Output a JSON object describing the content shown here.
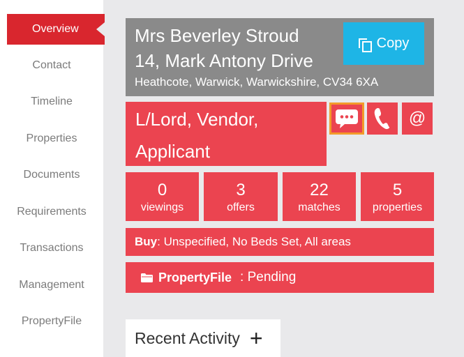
{
  "sidebar": {
    "items": [
      {
        "label": "Overview",
        "active": true
      },
      {
        "label": "Contact"
      },
      {
        "label": "Timeline"
      },
      {
        "label": "Properties"
      },
      {
        "label": "Documents"
      },
      {
        "label": "Requirements"
      },
      {
        "label": "Transactions"
      },
      {
        "label": "Management"
      },
      {
        "label": "PropertyFile"
      }
    ]
  },
  "contact": {
    "name": "Mrs Beverley Stroud",
    "address": "14, Mark Antony Drive",
    "locality": "Heathcote, Warwick, Warwickshire, CV34 6XA",
    "copy_label": "Copy",
    "roles_line1": "L/Lord, Vendor,",
    "roles_line2": "Applicant"
  },
  "actions": {
    "email_symbol": "@"
  },
  "stats": [
    {
      "value": "0",
      "label": "viewings"
    },
    {
      "value": "3",
      "label": "offers"
    },
    {
      "value": "22",
      "label": "matches"
    },
    {
      "value": "5",
      "label": "properties"
    }
  ],
  "buy": {
    "label": "Buy",
    "text": ": Unspecified, No Beds Set, All areas"
  },
  "propertyfile": {
    "brand": "PropertyFile",
    "status": ": Pending"
  },
  "activity": {
    "title": "Recent Activity",
    "add_symbol": "+"
  },
  "colors": {
    "accent_red": "#eb4450",
    "nav_active": "#d9262e",
    "copy_blue": "#1eb5e6",
    "header_grey": "#8a8a8a",
    "highlight_orange": "#f39a2a"
  }
}
